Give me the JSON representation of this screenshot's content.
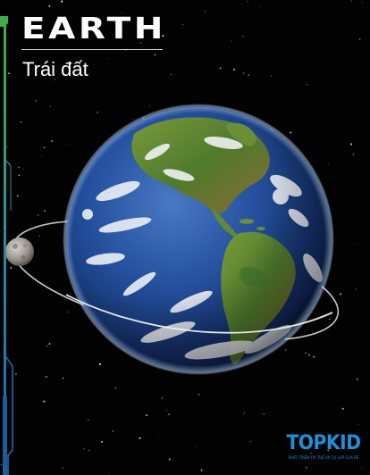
{
  "poster": {
    "title": "EARTH",
    "subtitle": "Trái đất"
  },
  "artwork": {
    "planet": "earth-globe",
    "satellite": "moon",
    "orbit": "moon-orbit-ring",
    "background": "starfield"
  },
  "brand": {
    "logo_text": "TOPKID",
    "tagline": "PHÁT TRIỂN TRÍ TUỆ VÀ TỰ LẬP CỦA BÉ"
  },
  "colors": {
    "background": "#020203",
    "ocean": "#1d3f8a",
    "land": "#5f8a33",
    "cloud": "#f2f4f8",
    "accent_green": "#3fae4a",
    "accent_blue": "#1f8fd6",
    "text": "#ffffff"
  }
}
